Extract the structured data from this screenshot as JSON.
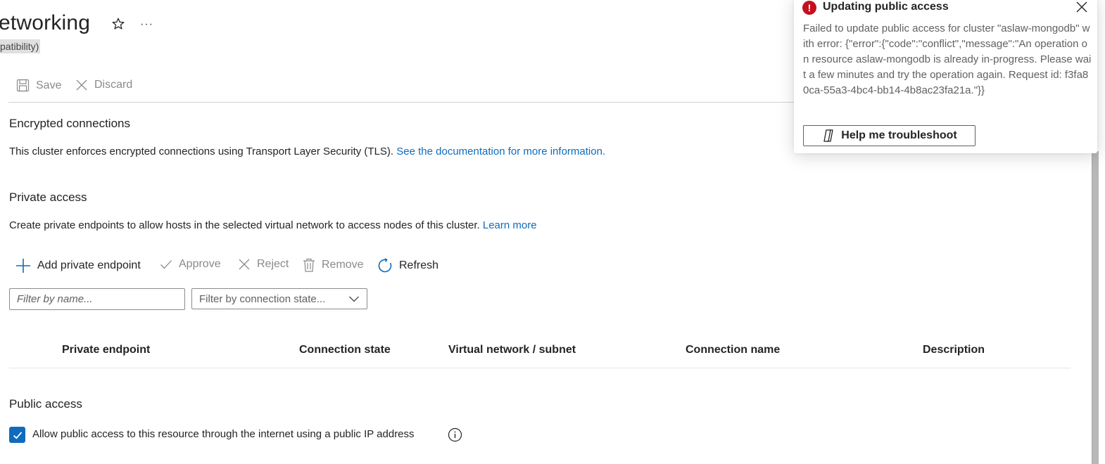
{
  "header": {
    "title": "etworking",
    "subtitle": "patibility)",
    "more_label": "···"
  },
  "toolbar": {
    "save_label": "Save",
    "discard_label": "Discard"
  },
  "encrypted": {
    "heading": "Encrypted connections",
    "description": "This cluster enforces encrypted connections using Transport Layer Security (TLS).",
    "link": "See the documentation for more information."
  },
  "private_access": {
    "heading": "Private access",
    "description": "Create private endpoints to allow hosts in the selected virtual network to access nodes of this cluster.",
    "link": "Learn more",
    "commands": {
      "add": "Add private endpoint",
      "approve": "Approve",
      "reject": "Reject",
      "remove": "Remove",
      "refresh": "Refresh"
    },
    "filter_name_placeholder": "Filter by name...",
    "filter_state_value": "Filter by connection state...",
    "columns": [
      "Private endpoint",
      "Connection state",
      "Virtual network / subnet",
      "Connection name",
      "Description"
    ]
  },
  "public_access": {
    "heading": "Public access",
    "checkbox_label": "Allow public access to this resource through the internet using a public IP address",
    "checked": true
  },
  "toast": {
    "title": "Updating public access",
    "body": "Failed to update public access for cluster \"aslaw-mongodb\" with error: {\"error\":{\"code\":\"conflict\",\"message\":\"An operation on resource aslaw-mongodb is already in-progress. Please wait a few minutes and try the operation again. Request id: f3fa80ca-55a3-4bc4-bb14-4b8ac23fa21a.\"}}",
    "button_label": "Help me troubleshoot",
    "error_glyph": "!"
  },
  "colors": {
    "accent": "#0f6cbd",
    "error": "#c50f1f",
    "disabled_text": "#8a8a8a"
  }
}
